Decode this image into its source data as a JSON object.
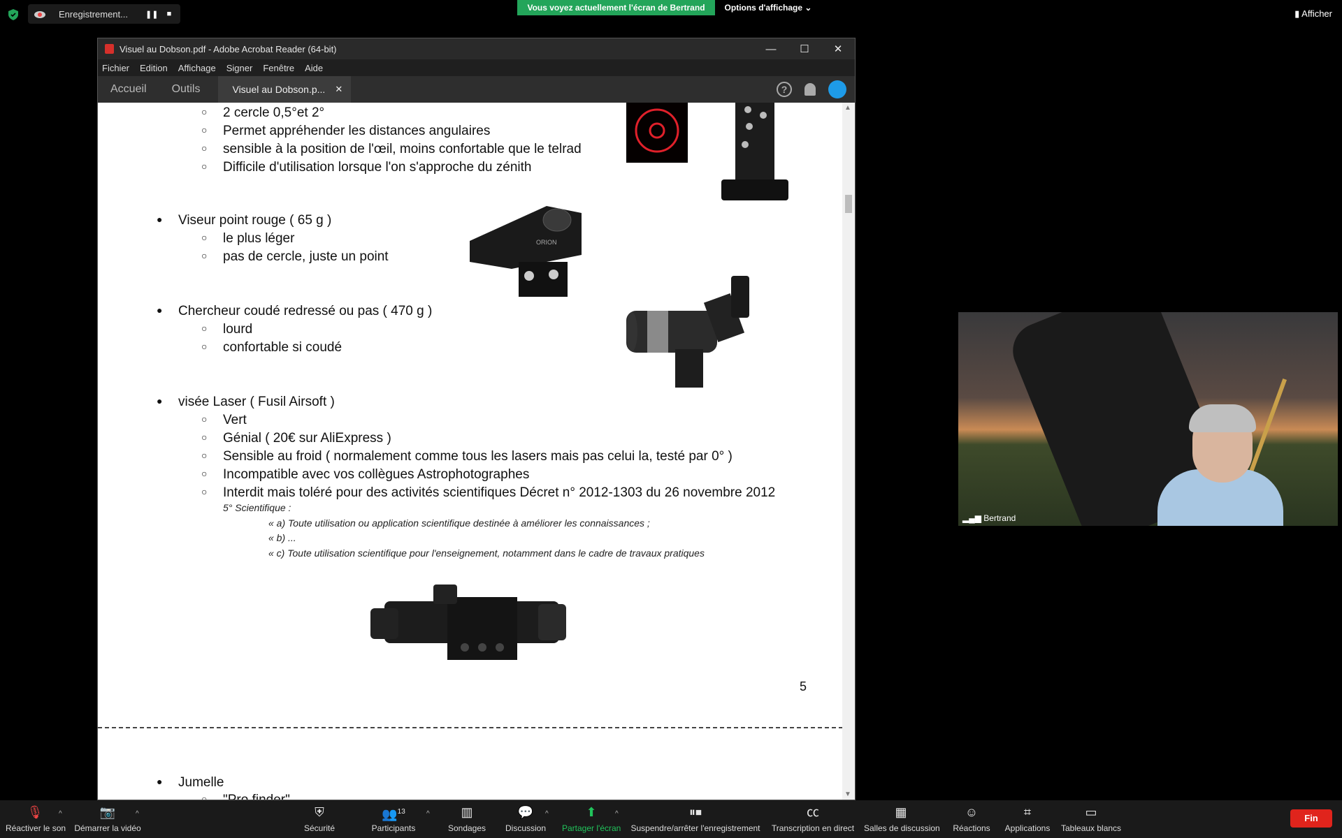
{
  "zoom": {
    "recording_label": "Enregistrement...",
    "pause_glyph": "❚❚",
    "stop_glyph": "■",
    "viewing_banner": "Vous voyez actuellement l'écran de Bertrand",
    "view_options": "Options d'affichage ⌄",
    "show_label": "Afficher",
    "participant_name": "Bertrand",
    "toolbar": {
      "unmute": "Réactiver le son",
      "start_video": "Démarrer la vidéo",
      "security": "Sécurité",
      "participants": "Participants",
      "participants_count": "13",
      "polls": "Sondages",
      "chat": "Discussion",
      "share": "Partager l'écran",
      "recording": "Suspendre/arrêter l'enregistrement",
      "transcription": "Transcription en direct",
      "breakout": "Salles de discussion",
      "reactions": "Réactions",
      "apps": "Applications",
      "whiteboards": "Tableaux blancs",
      "end": "Fin"
    },
    "colors": {
      "banner": "#23a55a",
      "end": "#e0241c",
      "share": "#21c35b"
    }
  },
  "acrobat": {
    "title": "Visuel au Dobson.pdf - Adobe Acrobat Reader (64-bit)",
    "menu": [
      "Fichier",
      "Edition",
      "Affichage",
      "Signer",
      "Fenêtre",
      "Aide"
    ],
    "tab_home": "Accueil",
    "tab_tools": "Outils",
    "doc_tab": "Visuel au Dobson.p...",
    "page_number": "5"
  },
  "content": {
    "l1": "2 cercle 0,5°et 2°",
    "l2": "Permet appréhender les distances angulaires",
    "l3": "sensible à la position de l'œil, moins confortable que le telrad",
    "l4": "Difficile d'utilisation lorsque l'on s'approche du zénith",
    "b1": "Viseur point rouge ( 65 g )",
    "b1a": "le plus léger",
    "b1b": "pas de cercle, juste un point",
    "b2": "Chercheur coudé redressé ou pas ( 470 g )",
    "b2a": "lourd",
    "b2b": "confortable si coudé",
    "b3": "visée Laser ( Fusil Airsoft )",
    "b3a": "Vert",
    "b3b": "Génial ( 20€ sur AliExpress )",
    "b3c": "Sensible au froid ( normalement comme tous les lasers mais pas celui la, testé par 0° )",
    "b3d": "Incompatible avec vos collègues Astrophotographes",
    "b3e": "Interdit mais toléré pour des activités scientifiques Décret n° 2012-1303 du 26 novembre 2012",
    "q0": "5° Scientifique :",
    "q1": "« a) Toute utilisation ou application scientifique destinée à améliorer les connaissances ;",
    "q2": "« b) ...",
    "q3": "« c) Toute utilisation scientifique pour l'enseignement, notamment dans le cadre de travaux pratiques",
    "b4": "Jumelle",
    "b4a": "\"Pro finder\""
  }
}
